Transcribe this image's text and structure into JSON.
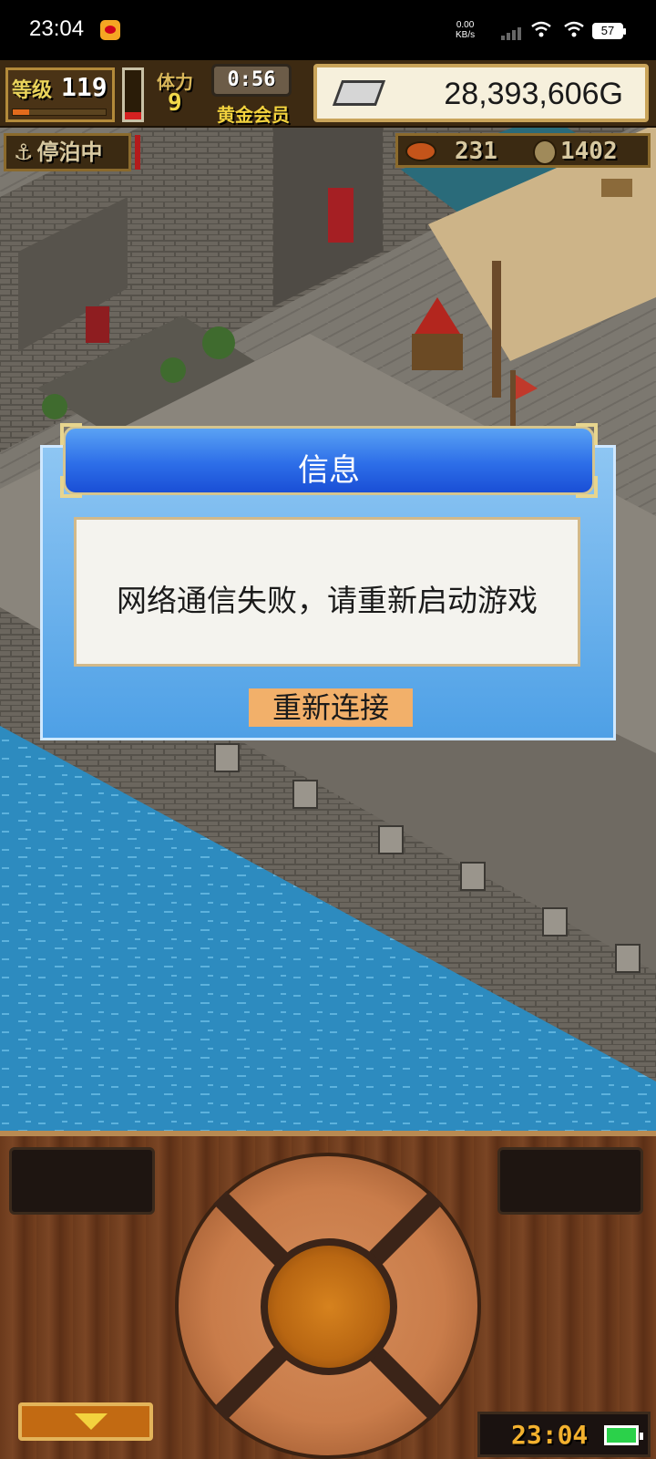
{
  "status_bar": {
    "time": "23:04",
    "network_speed_value": "0.00",
    "network_speed_unit": "KB/s",
    "battery": "57"
  },
  "hud": {
    "level_label": "等级",
    "level": "119",
    "stamina_label": "体力",
    "stamina": "9",
    "timer": "0:56",
    "membership": "黄金会员",
    "gold": "28,393,606G",
    "port_status": "停泊中",
    "food": "231",
    "coins": "1402"
  },
  "dialog": {
    "title": "信息",
    "message": "网络通信失败，请重新启动游戏",
    "button_label": "重新连接"
  },
  "controller": {
    "clock": "23:04"
  },
  "colors": {
    "dialog_blue": "#4ea0e6",
    "title_blue": "#2d6ee8",
    "button_orange": "#f2b06a",
    "water_blue": "#2d8bbf"
  }
}
